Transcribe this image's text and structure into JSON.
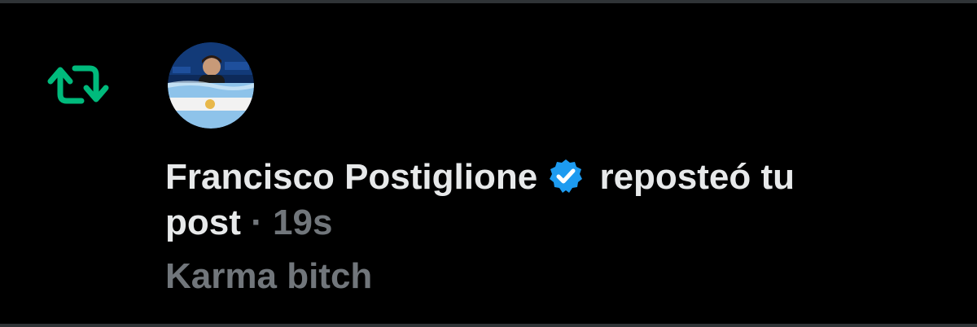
{
  "notification": {
    "icon": "repost-icon",
    "icon_color": "#00ba7c",
    "avatar_icon": "avatar",
    "user_name": "Francisco Postiglione",
    "verified_icon": "verified-badge-icon",
    "verified_color": "#1d9bf0",
    "action_line1": "reposteó tu",
    "action_line2": "post",
    "separator": "·",
    "timestamp": "19s",
    "post_preview": "Karma bitch"
  }
}
